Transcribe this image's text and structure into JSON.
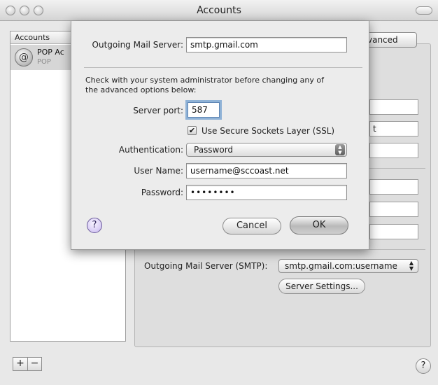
{
  "window": {
    "title": "Accounts"
  },
  "accounts": {
    "header": "Accounts",
    "items": [
      {
        "name": "POP Ac",
        "type": "POP",
        "icon": "at-sign-icon"
      }
    ],
    "add_label": "+",
    "remove_label": "−"
  },
  "background": {
    "advanced_tab": "vanced",
    "field_suffix": "t",
    "smtp_label": "Outgoing Mail Server (SMTP):",
    "smtp_value": "smtp.gmail.com:username",
    "server_settings_label": "Server Settings...",
    "help_label": "?"
  },
  "sheet": {
    "outgoing_label": "Outgoing Mail Server:",
    "outgoing_value": "smtp.gmail.com",
    "note": "Check with your system administrator before changing any of the advanced options below:",
    "port_label": "Server port:",
    "port_value": "587",
    "ssl_label": "Use Secure Sockets Layer (SSL)",
    "ssl_checked": true,
    "auth_label": "Authentication:",
    "auth_value": "Password",
    "username_label": "User Name:",
    "username_value": "username@sccoast.net",
    "password_label": "Password:",
    "password_value": "••••••••",
    "help_label": "?",
    "cancel_label": "Cancel",
    "ok_label": "OK"
  }
}
